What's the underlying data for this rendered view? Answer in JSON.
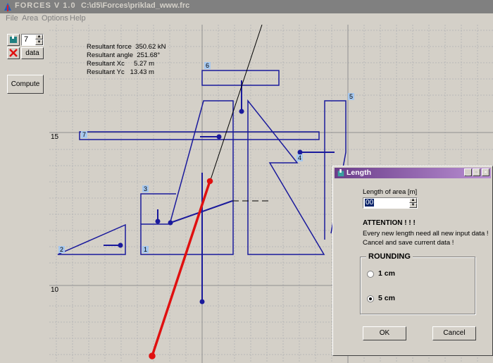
{
  "app": {
    "title": "FORCES  V 1.0",
    "file_path": "C:\\d5\\Forces\\priklad_www.frc"
  },
  "menu": [
    "File",
    "Area",
    "Options",
    "Help"
  ],
  "toolbar": {
    "area_number": "7",
    "data_label": "data",
    "compute_label": "Compute"
  },
  "results": {
    "force": "Resultant force  350.62 kN",
    "angle": "Resultant angle  251.68°",
    "xc": "Resultant Xc     5.27 m",
    "yc": "Resultant Yc   13.43 m"
  },
  "axes": {
    "y_tick_upper": "15",
    "y_tick_lower": "10"
  },
  "areas": [
    "1",
    "2",
    "3",
    "4",
    "5",
    "6",
    "7"
  ],
  "dialog": {
    "title": "Length",
    "length_label": "Length of area [m]",
    "length_value": "00",
    "attention": "ATTENTION  ! ! !",
    "msg1": "Every new length need all new input data !",
    "msg2": "Cancel and save current data !",
    "rounding_label": "ROUNDING",
    "option1": "1 cm",
    "option2": "5 cm",
    "selected": "5 cm",
    "ok_label": "OK",
    "cancel_label": "Cancel"
  },
  "colors": {
    "shapes": "#1a1a9c",
    "resultant": "#e01010",
    "grid": "#b8b8b8",
    "badge": "#a6c8f0"
  }
}
